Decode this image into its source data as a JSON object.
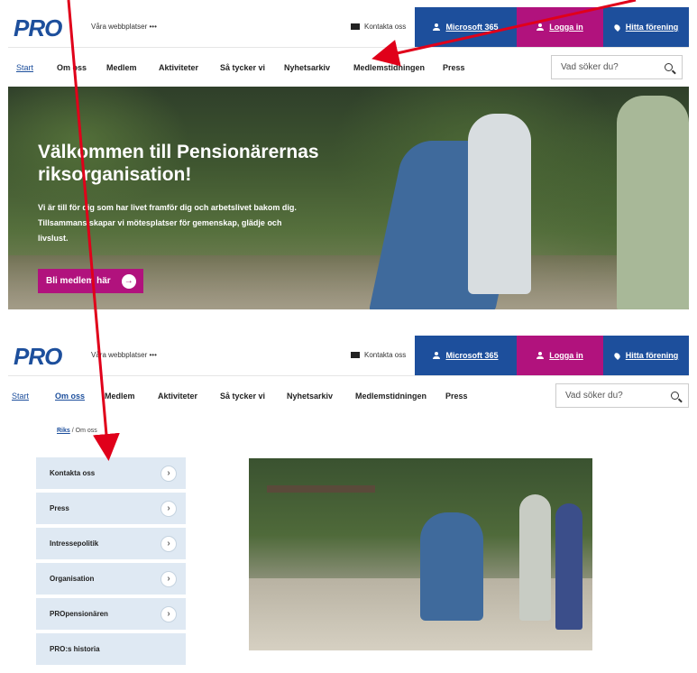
{
  "header": {
    "logo": "PRO",
    "sites_label": "Våra webbplatser •••",
    "contact_label": "Kontakta oss",
    "microsoft_label": "Microsoft 365",
    "login_label": "Logga in",
    "find_label": "Hitta förening"
  },
  "nav": {
    "items": [
      "Start",
      "Om oss",
      "Medlem",
      "Aktiviteter",
      "Så tycker vi",
      "Nyhetsarkiv",
      "Medlemstidningen",
      "Press"
    ],
    "search_placeholder": "Vad söker du?"
  },
  "hero": {
    "title": "Välkommen till Pensionärernas riksorganisation!",
    "text": "Vi är till för dig som har livet framför dig och arbetslivet bakom dig. Tillsammans skapar vi mötesplatser för gemenskap, glädje och livslust.",
    "cta_label": "Bli medlem här"
  },
  "page2": {
    "breadcrumb_root": "Riks",
    "breadcrumb_sep": " / ",
    "breadcrumb_current": "Om oss",
    "side_items": [
      "Kontakta oss",
      "Press",
      "Intressepolitik",
      "Organisation",
      "PROpensionären",
      "PRO:s historia"
    ]
  },
  "colors": {
    "brand_blue": "#1d4f9c",
    "magenta": "#b1127d",
    "annotation_red": "#e0001a",
    "side_bg": "#dfe9f3"
  },
  "icons": [
    "mail-icon",
    "person-icon",
    "pin-icon",
    "search-icon",
    "arrow-right-icon",
    "chevron-right-icon"
  ]
}
